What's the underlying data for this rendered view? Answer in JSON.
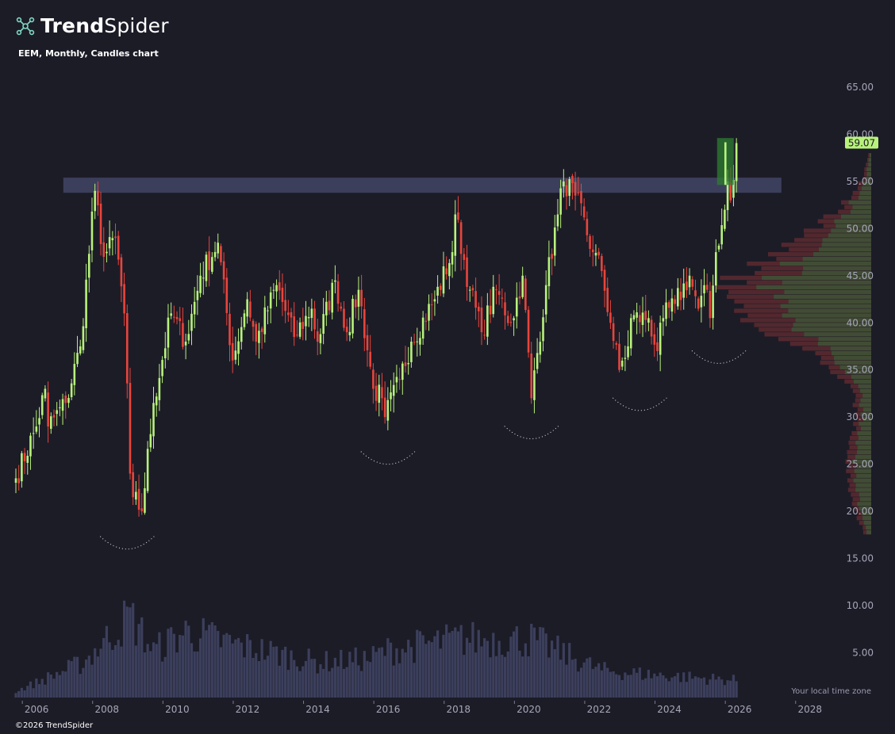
{
  "brand": {
    "bold": "Trend",
    "light": "Spider",
    "logo_icon": "trendspider-logo-icon"
  },
  "chart_title": "EEM, Monthly, Candles chart",
  "timezone_label": "Your local time zone",
  "copyright": "©2026 TrendSpider",
  "last_price_label": "59.07",
  "colors": {
    "background": "#1c1c27",
    "up": "#b8f27c",
    "down": "#e8453c",
    "resistance_zone": "#3f4260",
    "volume": "#3c3f5c",
    "profile_up": "#3f5036",
    "profile_down": "#5c2a30",
    "highlight_box": "#2e7d32",
    "price_badge": "#b8f27c"
  },
  "chart_data": {
    "type": "candlestick",
    "title": "EEM, Monthly, Candles chart",
    "x_axis": {
      "ticks": [
        "2006",
        "2008",
        "2010",
        "2012",
        "2014",
        "2016",
        "2018",
        "2020",
        "2022",
        "2024",
        "2026",
        "2028"
      ],
      "range": [
        "2005-07",
        "2029-07"
      ]
    },
    "y_axis": {
      "ticks": [
        "65.00",
        "60.00",
        "55.00",
        "50.00",
        "45.00",
        "40.00",
        "35.00",
        "30.00",
        "25.00",
        "20.00",
        "15.00",
        "10.00",
        "5.00"
      ],
      "range": [
        2.5,
        67.5
      ],
      "position": "right"
    },
    "last_price": 59.07,
    "resistance_zone": {
      "from": 53.8,
      "to": 55.4,
      "start": "2007-03",
      "end": "2027-03"
    },
    "highlight_box": {
      "from": 54.8,
      "to": 59.1,
      "start": "2025-11",
      "end": "2026-05"
    },
    "price_anchors": [
      [
        "2005-07",
        23.5
      ],
      [
        "2006-02",
        29
      ],
      [
        "2006-05",
        33
      ],
      [
        "2006-06",
        29
      ],
      [
        "2006-12",
        31.5
      ],
      [
        "2007-05",
        37.5
      ],
      [
        "2007-10",
        54
      ],
      [
        "2008-01",
        47
      ],
      [
        "2008-05",
        49
      ],
      [
        "2008-08",
        41
      ],
      [
        "2008-10",
        24
      ],
      [
        "2008-11",
        21.5
      ],
      [
        "2009-02",
        20
      ],
      [
        "2009-06",
        31.5
      ],
      [
        "2009-12",
        41
      ],
      [
        "2010-05",
        38
      ],
      [
        "2010-10",
        45
      ],
      [
        "2011-04",
        48.5
      ],
      [
        "2011-09",
        36
      ],
      [
        "2012-02",
        42.5
      ],
      [
        "2012-05",
        38
      ],
      [
        "2012-12",
        44
      ],
      [
        "2013-06",
        38.5
      ],
      [
        "2013-12",
        41.5
      ],
      [
        "2014-02",
        38
      ],
      [
        "2014-08",
        44.5
      ],
      [
        "2014-12",
        39
      ],
      [
        "2015-04",
        43.5
      ],
      [
        "2015-09",
        33
      ],
      [
        "2015-12",
        32
      ],
      [
        "2016-01",
        30
      ],
      [
        "2016-06",
        34
      ],
      [
        "2016-10",
        38
      ],
      [
        "2017-06",
        42.5
      ],
      [
        "2017-12",
        47.5
      ],
      [
        "2018-01",
        51.5
      ],
      [
        "2018-06",
        43.5
      ],
      [
        "2018-10",
        39
      ],
      [
        "2019-03",
        43.5
      ],
      [
        "2019-08",
        40
      ],
      [
        "2019-12",
        45
      ],
      [
        "2020-03",
        32
      ],
      [
        "2020-08",
        44
      ],
      [
        "2020-12",
        51.5
      ],
      [
        "2021-02",
        55
      ],
      [
        "2021-06",
        53.5
      ],
      [
        "2021-12",
        47.5
      ],
      [
        "2022-03",
        45.5
      ],
      [
        "2022-06",
        40
      ],
      [
        "2022-09",
        35
      ],
      [
        "2022-12",
        37.5
      ],
      [
        "2023-01",
        40.5
      ],
      [
        "2023-07",
        40.5
      ],
      [
        "2023-10",
        37
      ],
      [
        "2023-12",
        40.5
      ],
      [
        "2024-04",
        42
      ],
      [
        "2024-09",
        45
      ],
      [
        "2024-12",
        41.5
      ],
      [
        "2025-03",
        43.5
      ],
      [
        "2025-04",
        40.5
      ],
      [
        "2025-06",
        47.5
      ],
      [
        "2025-09",
        52
      ],
      [
        "2025-10",
        55
      ],
      [
        "2025-11",
        53
      ],
      [
        "2026-01",
        59.07
      ]
    ],
    "volume_axis_note": "volume bars share the price scale",
    "volume_peaks": [
      [
        "2005-07",
        0.8
      ],
      [
        "2007-06",
        4.5
      ],
      [
        "2008-10",
        10.5
      ],
      [
        "2009-06",
        6
      ],
      [
        "2010-05",
        8.5
      ],
      [
        "2011-08",
        7
      ],
      [
        "2014-02",
        4.5
      ],
      [
        "2015-08",
        5
      ],
      [
        "2016-01",
        6
      ],
      [
        "2018-02",
        7.5
      ],
      [
        "2020-03",
        7.5
      ],
      [
        "2021-06",
        5
      ],
      [
        "2022-03",
        3.5
      ],
      [
        "2023-06",
        3
      ],
      [
        "2026-01",
        2.2
      ]
    ],
    "volume_profile": {
      "levels_from": 17.5,
      "levels_to": 57.5,
      "peak_at": 43,
      "note": "horizontal volume-at-price histogram, right side"
    },
    "annotations": [
      "dotted arc 2008-09",
      "dotted arc 2016-02",
      "dotted arc 2020-03",
      "dotted arc 2023-04",
      "dotted arc 2025-07"
    ]
  }
}
